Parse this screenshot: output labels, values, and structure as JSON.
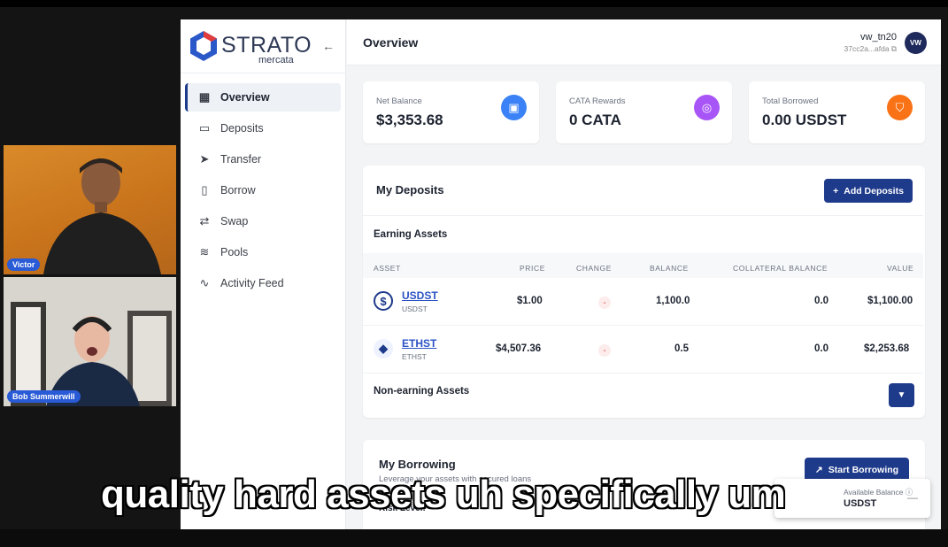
{
  "participants": [
    {
      "name": "Victor"
    },
    {
      "name": "Bob Summerwill"
    }
  ],
  "brand": {
    "name": "STRATO",
    "sub": "mercata"
  },
  "sidebar": {
    "items": [
      {
        "label": "Overview",
        "icon": "grid-icon"
      },
      {
        "label": "Deposits",
        "icon": "wallet-icon"
      },
      {
        "label": "Transfer",
        "icon": "send-icon"
      },
      {
        "label": "Borrow",
        "icon": "book-icon"
      },
      {
        "label": "Swap",
        "icon": "swap-icon"
      },
      {
        "label": "Pools",
        "icon": "database-icon"
      },
      {
        "label": "Activity Feed",
        "icon": "activity-icon"
      }
    ]
  },
  "header": {
    "title": "Overview",
    "user": "vw_tn20",
    "address": "37cc2a...afda",
    "avatar": "VW"
  },
  "stats": [
    {
      "label": "Net Balance",
      "value": "$3,353.68",
      "color": "#3b82f6",
      "icon": "wallet-icon"
    },
    {
      "label": "CATA Rewards",
      "value": "0 CATA",
      "color": "#a855f7",
      "icon": "coins-icon"
    },
    {
      "label": "Total Borrowed",
      "value": "0.00 USDST",
      "color": "#f97316",
      "icon": "shield-icon"
    }
  ],
  "deposits": {
    "title": "My Deposits",
    "add_label": "Add Deposits",
    "earning_title": "Earning Assets",
    "non_earning_title": "Non-earning Assets",
    "columns": [
      "ASSET",
      "PRICE",
      "CHANGE",
      "BALANCE",
      "COLLATERAL BALANCE",
      "VALUE"
    ],
    "rows": [
      {
        "name": "USDST",
        "symbol": "USDST",
        "price": "$1.00",
        "change": "-",
        "balance": "1,100.0",
        "collateral": "0.0",
        "value": "$1,100.00"
      },
      {
        "name": "ETHST",
        "symbol": "ETHST",
        "price": "$4,507.36",
        "change": "-",
        "balance": "0.5",
        "collateral": "0.0",
        "value": "$2,253.68"
      }
    ]
  },
  "borrowing": {
    "title": "My Borrowing",
    "subtitle": "Leverage your assets with secured loans",
    "start_label": "Start Borrowing",
    "risk_label": "Risk Level:"
  },
  "popup": {
    "label": "Available Balance",
    "value": "USDST"
  },
  "caption": "quality hard assets uh specifically um"
}
